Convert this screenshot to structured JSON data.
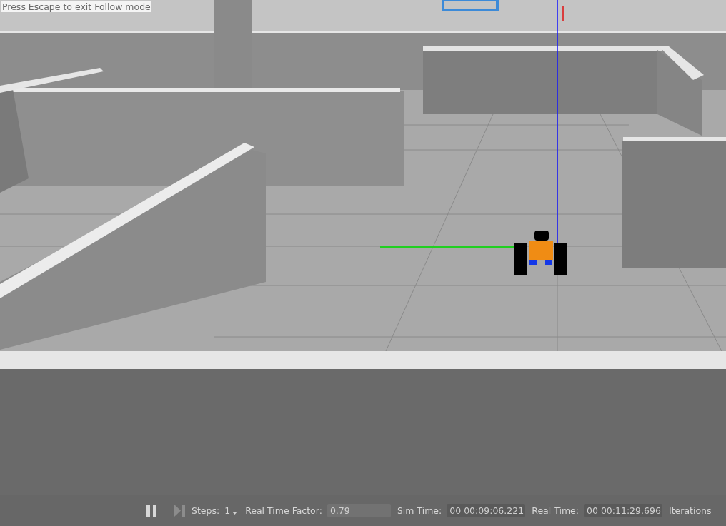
{
  "overlay": {
    "text": "Press Escape to exit Follow mode"
  },
  "toolbar": {
    "steps_label": "Steps:",
    "steps_value": "1",
    "rtf_label": "Real Time Factor:",
    "rtf_value": "0.79",
    "sim_time_label": "Sim Time:",
    "sim_time_value": "00 00:09:06.221",
    "real_time_label": "Real Time:",
    "real_time_value": "00 00:11:29.696",
    "iterations_label": "Iterations"
  }
}
